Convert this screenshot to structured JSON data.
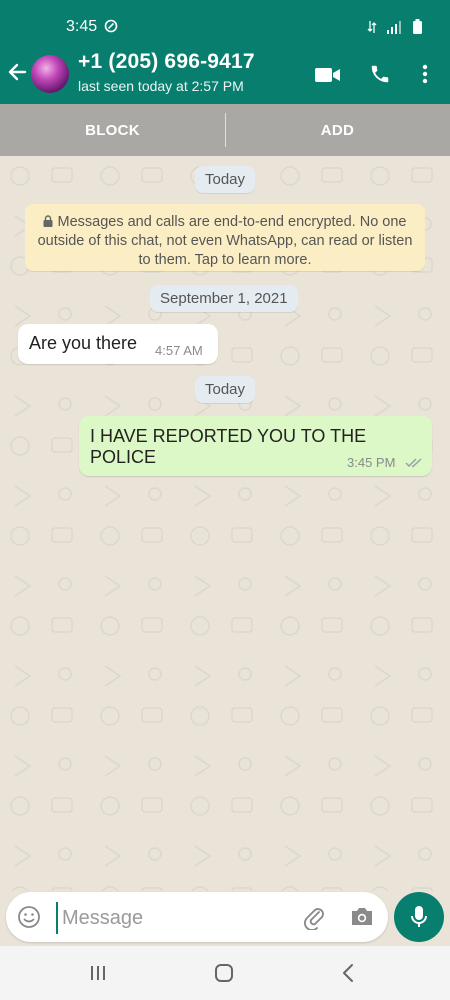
{
  "status_bar": {
    "time": "3:45"
  },
  "header": {
    "contact_name": "+1 (205) 696-9417",
    "last_seen": "last seen today at 2:57 PM"
  },
  "actions": {
    "block_label": "BLOCK",
    "add_label": "ADD"
  },
  "chat": {
    "date_chips": [
      "Today",
      "September 1, 2021",
      "Today"
    ],
    "encryption_notice": "Messages and calls are end-to-end encrypted. No one outside of this chat, not even WhatsApp, can read or listen to them. Tap to learn more.",
    "messages": [
      {
        "direction": "incoming",
        "text": "Are you there",
        "time": "4:57 AM"
      },
      {
        "direction": "outgoing",
        "text": "I HAVE REPORTED YOU TO THE POLICE",
        "time": "3:45 PM",
        "status": "delivered"
      }
    ]
  },
  "composer": {
    "placeholder": "Message"
  },
  "colors": {
    "primary": "#087e6e",
    "outgoing_bubble": "#dcf8c6",
    "notice": "#fceec4"
  }
}
